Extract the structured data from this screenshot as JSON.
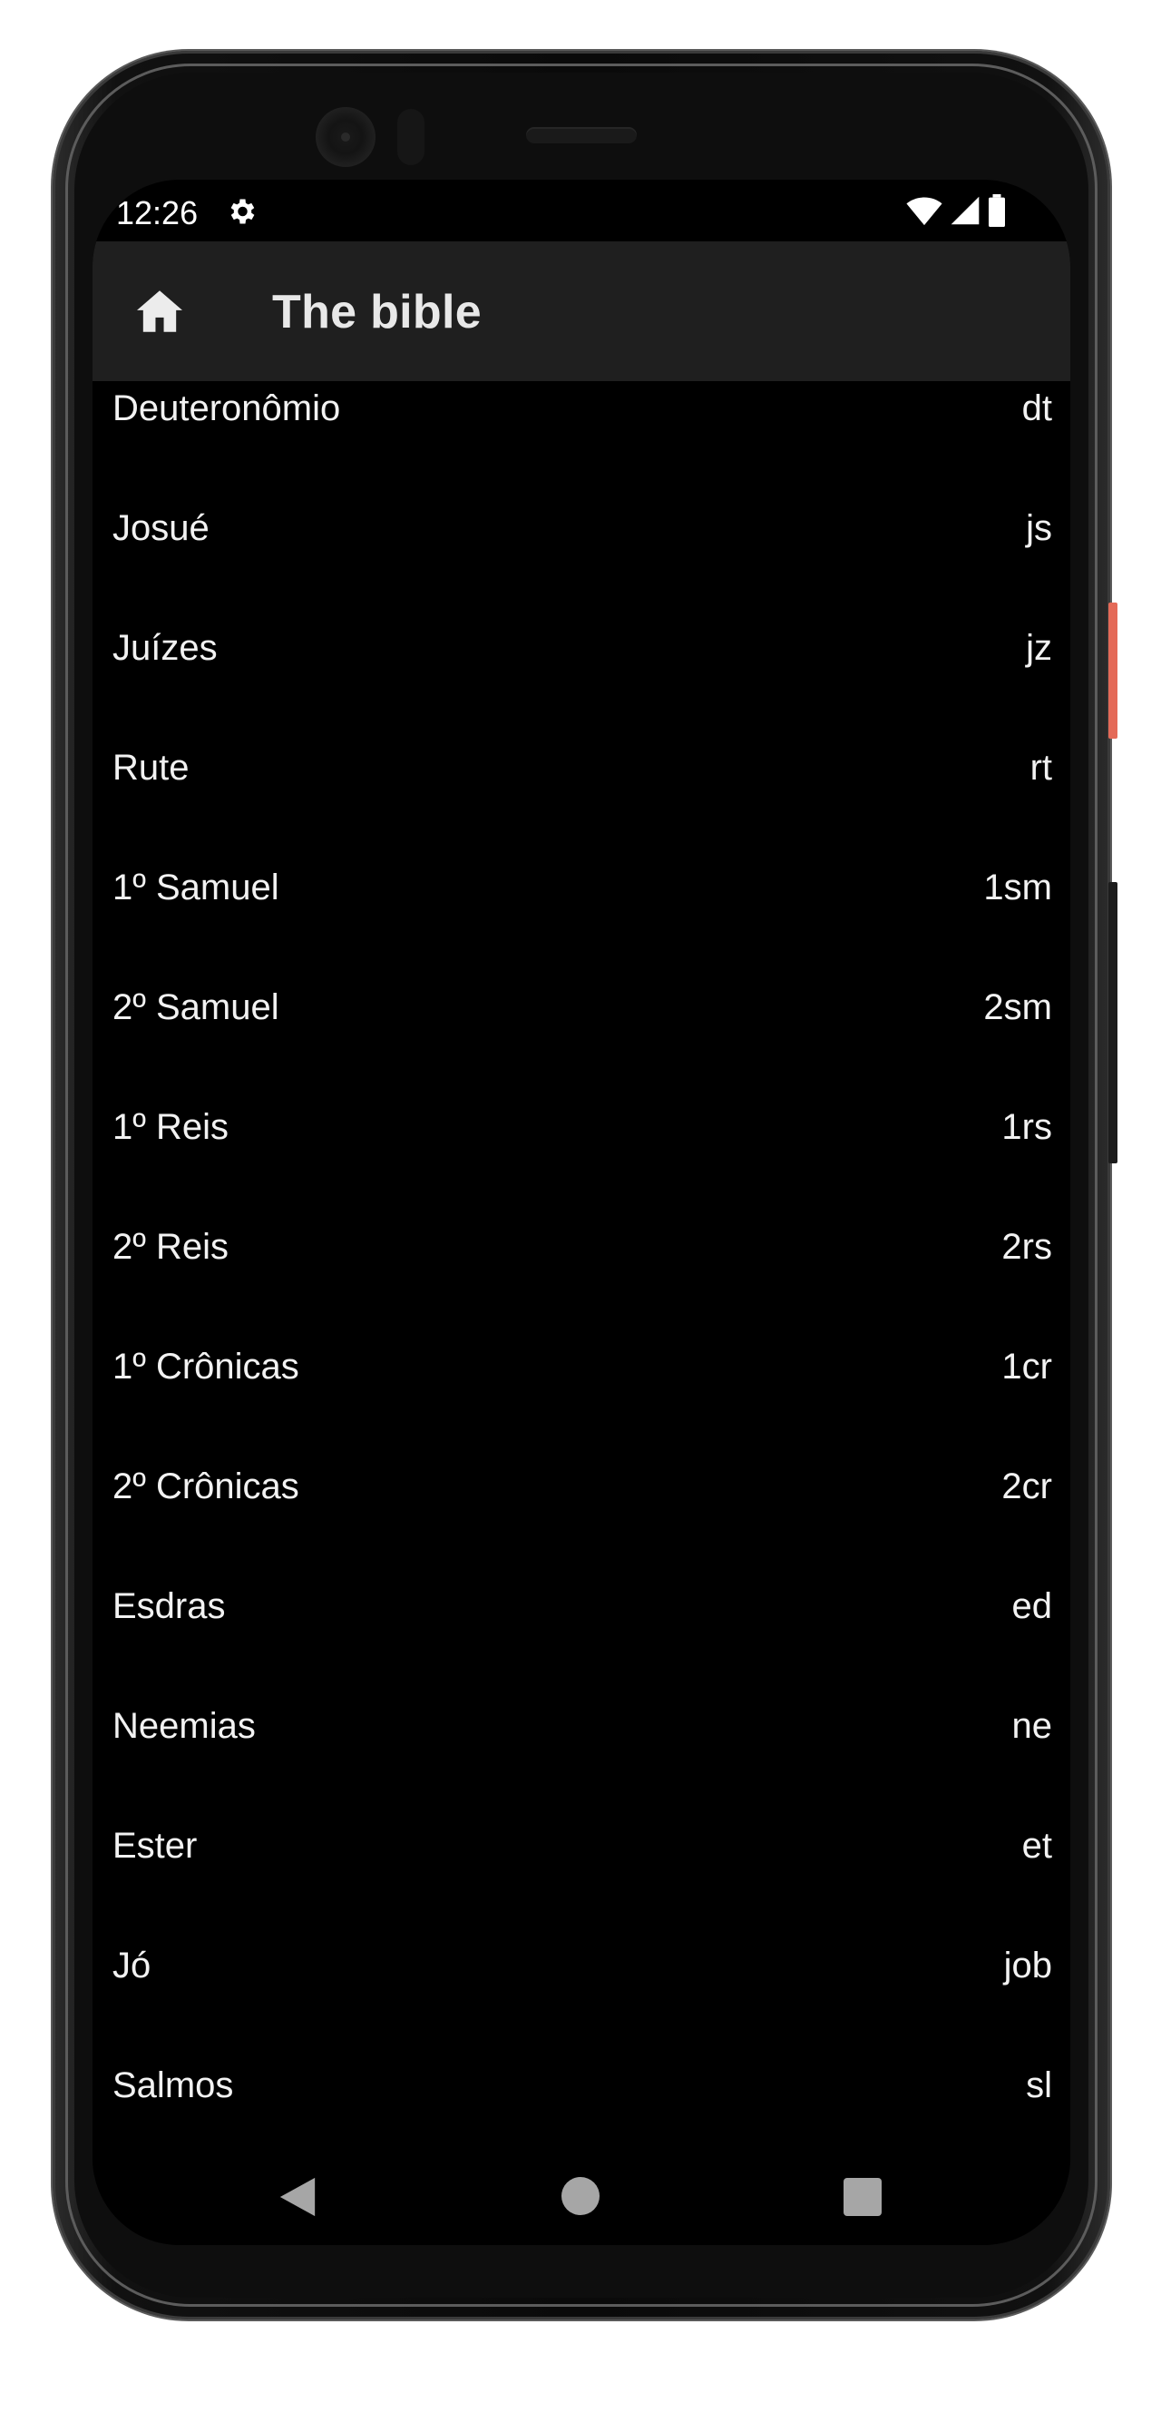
{
  "status_bar": {
    "time": "12:26",
    "icons": [
      "settings-gear-icon",
      "wifi-icon",
      "cellular-signal-icon",
      "battery-icon"
    ]
  },
  "app_bar": {
    "home_icon": "home-icon",
    "title": "The bible"
  },
  "books": [
    {
      "name": "Deuteronômio",
      "abbr": "dt"
    },
    {
      "name": "Josué",
      "abbr": "js"
    },
    {
      "name": "Juízes",
      "abbr": "jz"
    },
    {
      "name": "Rute",
      "abbr": "rt"
    },
    {
      "name": "1º Samuel",
      "abbr": "1sm"
    },
    {
      "name": "2º Samuel",
      "abbr": "2sm"
    },
    {
      "name": "1º Reis",
      "abbr": "1rs"
    },
    {
      "name": "2º Reis",
      "abbr": "2rs"
    },
    {
      "name": "1º Crônicas",
      "abbr": "1cr"
    },
    {
      "name": "2º Crônicas",
      "abbr": "2cr"
    },
    {
      "name": "Esdras",
      "abbr": "ed"
    },
    {
      "name": "Neemias",
      "abbr": "ne"
    },
    {
      "name": "Ester",
      "abbr": "et"
    },
    {
      "name": "Jó",
      "abbr": "job"
    },
    {
      "name": "Salmos",
      "abbr": "sl"
    }
  ],
  "nav_bar": {
    "back": "back-triangle-icon",
    "home": "home-circle-icon",
    "recents": "recents-square-icon"
  },
  "colors": {
    "screen_background": "#000000",
    "app_bar_background": "#1f1f1f",
    "text": "#f2f2f2",
    "nav_icons": "#a6a6a6"
  }
}
